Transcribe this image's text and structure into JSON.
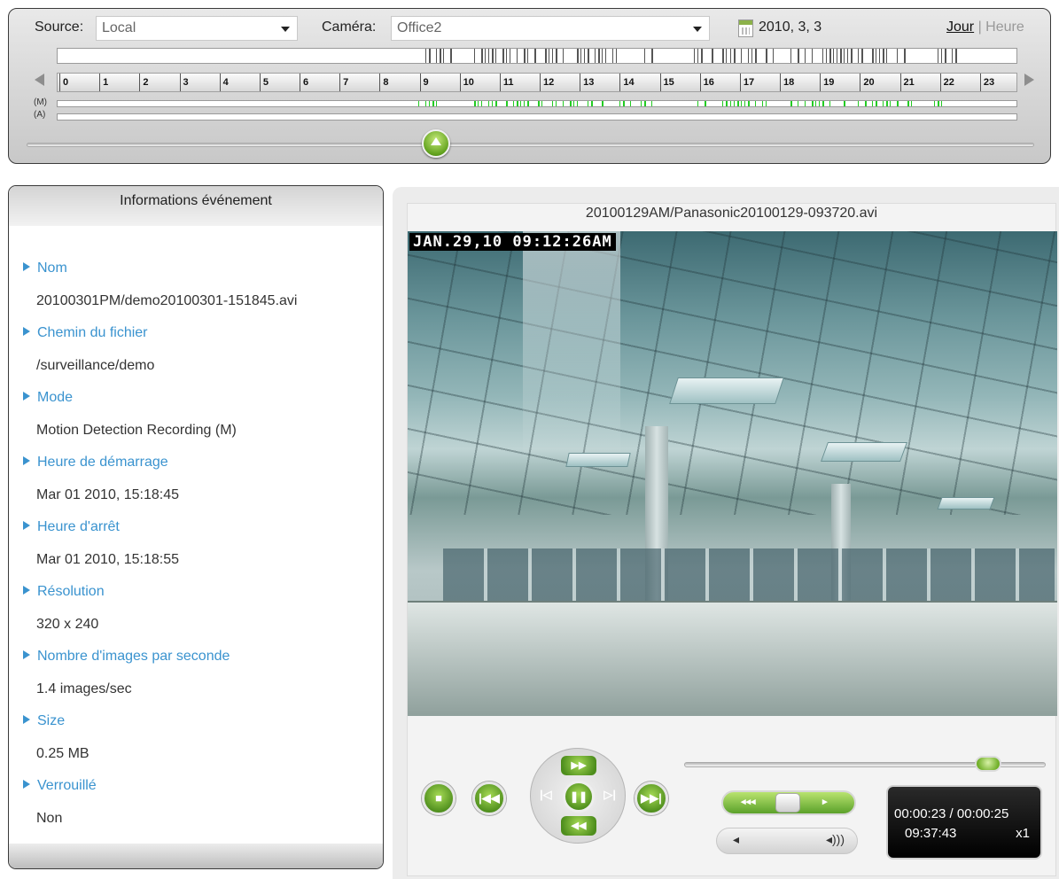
{
  "toolbar": {
    "source_label": "Source:",
    "source_value": "Local",
    "camera_label": "Caméra:",
    "camera_value": "Office2",
    "date": "2010, 3, 3",
    "view_day": "Jour",
    "view_sep": " | ",
    "view_hour": "Heure"
  },
  "timeline": {
    "hours": [
      "0",
      "1",
      "2",
      "3",
      "4",
      "5",
      "6",
      "7",
      "8",
      "9",
      "10",
      "11",
      "12",
      "13",
      "14",
      "15",
      "16",
      "17",
      "18",
      "19",
      "20",
      "21",
      "22",
      "23"
    ],
    "row_m_label": "(M)",
    "row_a_label": "(A)",
    "slider_hour": 9.4
  },
  "info": {
    "header": "Informations événement",
    "fields": [
      {
        "label": "Nom",
        "value": "20100301PM/demo20100301-151845.avi"
      },
      {
        "label": "Chemin du fichier",
        "value": "/surveillance/demo"
      },
      {
        "label": "Mode",
        "value": "Motion Detection Recording (M)"
      },
      {
        "label": "Heure de démarrage",
        "value": "Mar 01 2010, 15:18:45"
      },
      {
        "label": "Heure d'arrêt",
        "value": "Mar 01 2010, 15:18:55"
      },
      {
        "label": "Résolution",
        "value": "320 x 240"
      },
      {
        "label": "Nombre d'images par seconde",
        "value": "1.4 images/sec"
      },
      {
        "label": "Size",
        "value": "0.25 MB"
      },
      {
        "label": "Verrouillé",
        "value": "Non"
      }
    ]
  },
  "player": {
    "file_title": "20100129AM/Panasonic20100129-093720.avi",
    "osd_text": "JAN.29,10 09:12:26AM",
    "elapsed": "00:00:23 / 00:00:25",
    "clock": "09:37:43",
    "speed": "x1",
    "seek_progress": 0.92,
    "icons": {
      "stop": "stop-icon",
      "prev": "skip-back-icon",
      "next": "skip-forward-icon",
      "ffwd": "fast-forward-icon",
      "rew": "rewind-icon",
      "pause": "pause-icon",
      "volume_low": "volume-low-icon",
      "volume_high": "volume-high-icon"
    }
  },
  "colors": {
    "accent_green": "#4d8d1c",
    "label_blue": "#3a93cf",
    "motion_green": "#22cc22"
  }
}
